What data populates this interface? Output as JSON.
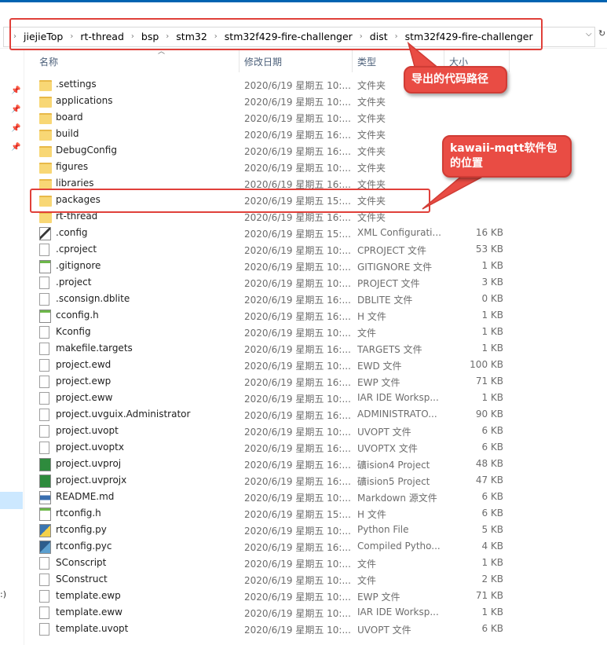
{
  "breadcrumb": [
    "jiejieTop",
    "rt-thread",
    "bsp",
    "stm32",
    "stm32f429-fire-challenger",
    "dist",
    "stm32f429-fire-challenger"
  ],
  "columns": {
    "name": "名称",
    "date": "修改日期",
    "type": "类型",
    "size": "大小"
  },
  "callouts": {
    "export_path": "导出的代码路径",
    "package_location": "kawaii-mqtt软件包的位置"
  },
  "left_pane": {
    "colon_text": ":)"
  },
  "accent_colors": {
    "annotation": "#e94c44",
    "selection": "#cce8ff",
    "folder": "#f8d775"
  },
  "files": [
    {
      "name": ".settings",
      "date": "2020/6/19 星期五 10:...",
      "type": "文件夹",
      "size": "",
      "icon": "folder-icon"
    },
    {
      "name": "applications",
      "date": "2020/6/19 星期五 10:...",
      "type": "文件夹",
      "size": "",
      "icon": "folder-icon"
    },
    {
      "name": "board",
      "date": "2020/6/19 星期五 10:...",
      "type": "文件夹",
      "size": "",
      "icon": "folder-icon"
    },
    {
      "name": "build",
      "date": "2020/6/19 星期五 16:...",
      "type": "文件夹",
      "size": "",
      "icon": "folder-icon"
    },
    {
      "name": "DebugConfig",
      "date": "2020/6/19 星期五 16:...",
      "type": "文件夹",
      "size": "",
      "icon": "folder-icon"
    },
    {
      "name": "figures",
      "date": "2020/6/19 星期五 10:...",
      "type": "文件夹",
      "size": "",
      "icon": "folder-icon"
    },
    {
      "name": "libraries",
      "date": "2020/6/19 星期五 16:...",
      "type": "文件夹",
      "size": "",
      "icon": "folder-icon"
    },
    {
      "name": "packages",
      "date": "2020/6/19 星期五 15:...",
      "type": "文件夹",
      "size": "",
      "icon": "folder-icon"
    },
    {
      "name": "rt-thread",
      "date": "2020/6/19 星期五 16:...",
      "type": "文件夹",
      "size": "",
      "icon": "folder-icon"
    },
    {
      "name": ".config",
      "date": "2020/6/19 星期五 15:...",
      "type": "XML Configurati...",
      "size": "16 KB",
      "icon": "xml-file-icon"
    },
    {
      "name": ".cproject",
      "date": "2020/6/19 星期五 10:...",
      "type": "CPROJECT 文件",
      "size": "53 KB",
      "icon": "file-icon"
    },
    {
      "name": ".gitignore",
      "date": "2020/6/19 星期五 10:...",
      "type": "GITIGNORE 文件",
      "size": "1 KB",
      "icon": "notepad-file-icon"
    },
    {
      "name": ".project",
      "date": "2020/6/19 星期五 10:...",
      "type": "PROJECT 文件",
      "size": "3 KB",
      "icon": "file-icon"
    },
    {
      "name": ".sconsign.dblite",
      "date": "2020/6/19 星期五 16:...",
      "type": "DBLITE 文件",
      "size": "0 KB",
      "icon": "file-icon"
    },
    {
      "name": "cconfig.h",
      "date": "2020/6/19 星期五 16:...",
      "type": "H 文件",
      "size": "1 KB",
      "icon": "notepad-file-icon"
    },
    {
      "name": "Kconfig",
      "date": "2020/6/19 星期五 10:...",
      "type": "文件",
      "size": "1 KB",
      "icon": "file-icon"
    },
    {
      "name": "makefile.targets",
      "date": "2020/6/19 星期五 16:...",
      "type": "TARGETS 文件",
      "size": "1 KB",
      "icon": "file-icon"
    },
    {
      "name": "project.ewd",
      "date": "2020/6/19 星期五 10:...",
      "type": "EWD 文件",
      "size": "100 KB",
      "icon": "file-icon"
    },
    {
      "name": "project.ewp",
      "date": "2020/6/19 星期五 16:...",
      "type": "EWP 文件",
      "size": "71 KB",
      "icon": "file-icon"
    },
    {
      "name": "project.eww",
      "date": "2020/6/19 星期五 10:...",
      "type": "IAR IDE Worksp...",
      "size": "1 KB",
      "icon": "file-icon"
    },
    {
      "name": "project.uvguix.Administrator",
      "date": "2020/6/19 星期五 16:...",
      "type": "ADMINISTRATO...",
      "size": "90 KB",
      "icon": "file-icon"
    },
    {
      "name": "project.uvopt",
      "date": "2020/6/19 星期五 10:...",
      "type": "UVOPT 文件",
      "size": "6 KB",
      "icon": "file-icon"
    },
    {
      "name": "project.uvoptx",
      "date": "2020/6/19 星期五 16:...",
      "type": "UVOPTX 文件",
      "size": "6 KB",
      "icon": "file-icon"
    },
    {
      "name": "project.uvproj",
      "date": "2020/6/19 星期五 16:...",
      "type": "礦ision4 Project",
      "size": "48 KB",
      "icon": "keil-file-icon"
    },
    {
      "name": "project.uvprojx",
      "date": "2020/6/19 星期五 16:...",
      "type": "礦ision5 Project",
      "size": "47 KB",
      "icon": "keil-file-icon"
    },
    {
      "name": "README.md",
      "date": "2020/6/19 星期五 10:...",
      "type": "Markdown 源文件",
      "size": "6 KB",
      "icon": "markdown-file-icon"
    },
    {
      "name": "rtconfig.h",
      "date": "2020/6/19 星期五 15:...",
      "type": "H 文件",
      "size": "6 KB",
      "icon": "notepad-file-icon"
    },
    {
      "name": "rtconfig.py",
      "date": "2020/6/19 星期五 10:...",
      "type": "Python File",
      "size": "5 KB",
      "icon": "python-file-icon"
    },
    {
      "name": "rtconfig.pyc",
      "date": "2020/6/19 星期五 16:...",
      "type": "Compiled Pytho...",
      "size": "4 KB",
      "icon": "python-compiled-icon"
    },
    {
      "name": "SConscript",
      "date": "2020/6/19 星期五 10:...",
      "type": "文件",
      "size": "1 KB",
      "icon": "file-icon"
    },
    {
      "name": "SConstruct",
      "date": "2020/6/19 星期五 10:...",
      "type": "文件",
      "size": "2 KB",
      "icon": "file-icon"
    },
    {
      "name": "template.ewp",
      "date": "2020/6/19 星期五 10:...",
      "type": "EWP 文件",
      "size": "71 KB",
      "icon": "file-icon"
    },
    {
      "name": "template.eww",
      "date": "2020/6/19 星期五 10:...",
      "type": "IAR IDE Worksp...",
      "size": "1 KB",
      "icon": "file-icon"
    },
    {
      "name": "template.uvopt",
      "date": "2020/6/19 星期五 10:...",
      "type": "UVOPT 文件",
      "size": "6 KB",
      "icon": "file-icon"
    }
  ]
}
